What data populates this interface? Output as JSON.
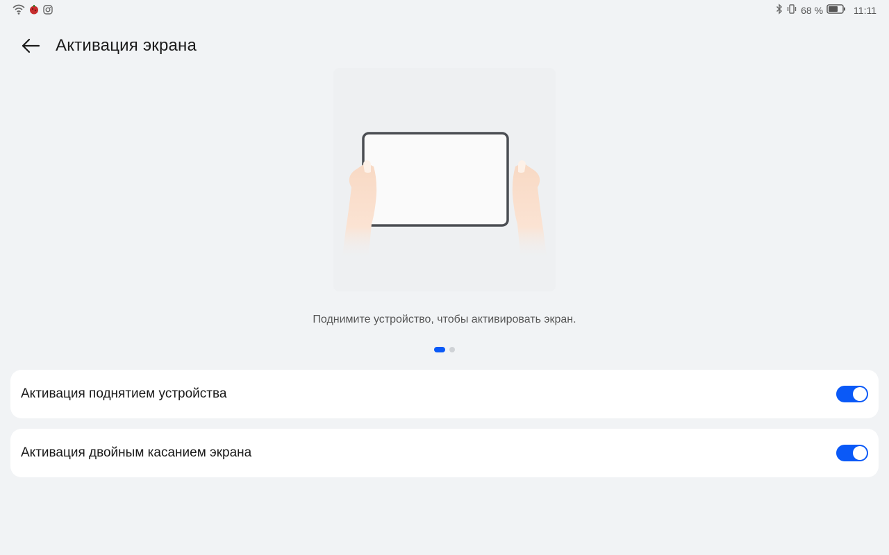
{
  "status_bar": {
    "left_icons": [
      "wifi-icon",
      "app-notification-icon",
      "instagram-icon"
    ],
    "right_icons": [
      "bluetooth-icon",
      "vibrate-icon",
      "battery-icon"
    ],
    "battery_percent": "68 %",
    "time": "11:11"
  },
  "header": {
    "back_icon": "arrow-left-icon",
    "title": "Активация экрана"
  },
  "illustration": {
    "caption": "Поднимите устройство, чтобы активировать экран."
  },
  "pager": {
    "count": 2,
    "active_index": 0
  },
  "settings": [
    {
      "label": "Активация поднятием устройства",
      "enabled": true
    },
    {
      "label": "Активация двойным касанием экрана",
      "enabled": true
    }
  ],
  "colors": {
    "accent": "#0a59f7",
    "background": "#f1f3f5",
    "card": "#ffffff"
  }
}
